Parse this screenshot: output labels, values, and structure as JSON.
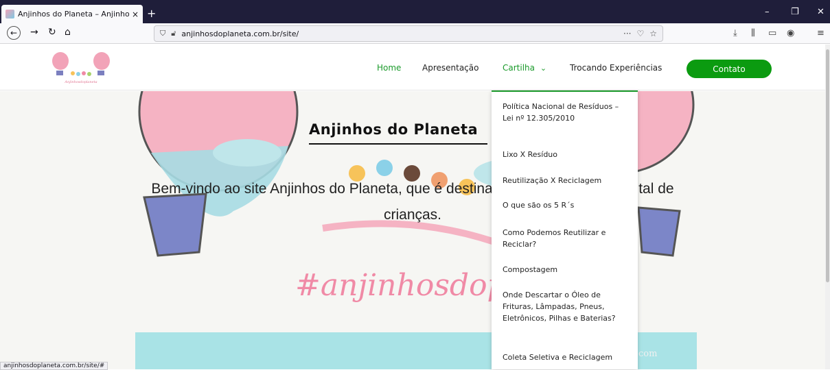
{
  "browser": {
    "tab_title": "Anjinhos do Planeta – Anjinhos",
    "tab_close": "×",
    "new_tab": "+",
    "url": "anjinhosdoplaneta.com.br/site/",
    "url_more": "···",
    "status_url": "anjinhosdoplaneta.com.br/site/#"
  },
  "site": {
    "logo_caption": "Anjinhosdoplaneta",
    "menu": {
      "home": "Home",
      "apresentacao": "Apresentação",
      "cartilha": "Cartilha",
      "cartilha_caret": "⌄",
      "trocando": "Trocando Experiências",
      "contato": "Contato"
    },
    "hero": {
      "title": "Anjinhos do Planeta",
      "text_line1": "Bem-vindo ao site Anjinhos do Planeta, que é destinado à educação ambiental de",
      "text_line2": "crianças.",
      "hashtag": "#anjinhosdoplaneta",
      "teal_text": "com"
    },
    "dropdown": [
      "Política Nacional de Resíduos – Lei nº 12.305/2010",
      "Lixo X Resíduo",
      "Reutilização X Reciclagem",
      "O que são os 5 R´s",
      "Como Podemos Reutilizar e Reciclar?",
      "Compostagem",
      "Onde Descartar o Óleo de Frituras, Lâmpadas, Pneus, Eletrônicos, Pilhas e Baterias?",
      "Coleta Seletiva e Reciclagem"
    ]
  },
  "colors": {
    "accent_green": "#1a9a2a",
    "button_green": "#0b9b10",
    "hashtag_pink": "#f08aa6",
    "teal": "#a9e3e6"
  }
}
